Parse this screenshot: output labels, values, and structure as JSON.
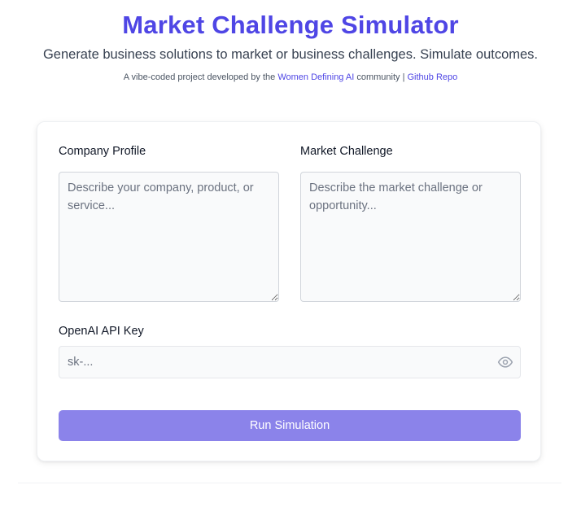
{
  "header": {
    "title": "Market Challenge Simulator",
    "subtitle": "Generate business solutions to market or business challenges. Simulate outcomes.",
    "credits_prefix": "A vibe-coded project developed by the ",
    "community_link": "Women Defining AI",
    "credits_middle": " community | ",
    "repo_link": "Github Repo"
  },
  "form": {
    "company_profile": {
      "label": "Company Profile",
      "value": "",
      "placeholder": "Describe your company, product, or service..."
    },
    "market_challenge": {
      "label": "Market Challenge",
      "value": "",
      "placeholder": "Describe the market challenge or opportunity..."
    },
    "api_key": {
      "label": "OpenAI API Key",
      "value": "",
      "placeholder": "sk-...",
      "toggle_icon": "eye-icon"
    },
    "run_button_label": "Run Simulation"
  },
  "colors": {
    "brand": "#4f46e5",
    "button": "#8b83ea"
  }
}
